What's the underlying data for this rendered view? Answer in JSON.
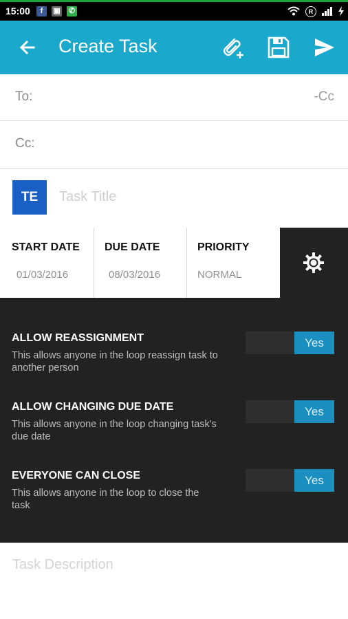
{
  "status_bar": {
    "time": "15:00",
    "notif_icons": [
      "facebook-icon",
      "gallery-icon",
      "whatsapp-icon"
    ],
    "right_icons": [
      "wifi-icon",
      "r-icon",
      "signal-icon",
      "charging-icon"
    ],
    "r_glyph": "R"
  },
  "app_bar": {
    "title": "Create Task",
    "color": "#1aa8cc"
  },
  "recipients": {
    "to_label": "To:",
    "cc_toggle": "-Cc",
    "cc_label": "Cc:"
  },
  "task": {
    "avatar_initials": "TE",
    "avatar_color": "#1a5fc4",
    "title_placeholder": "Task Title"
  },
  "meta": {
    "start_date": {
      "label": "START DATE",
      "value": "01/03/2016"
    },
    "due_date": {
      "label": "DUE DATE",
      "value": "08/03/2016"
    },
    "priority": {
      "label": "PRIORITY",
      "value": "NORMAL"
    }
  },
  "settings": [
    {
      "title": "ALLOW REASSIGNMENT",
      "description": "This allows anyone in the loop reassign task to another person",
      "toggle": "Yes"
    },
    {
      "title": "ALLOW CHANGING DUE DATE",
      "description": "This allows anyone in the loop changing task's due date",
      "toggle": "Yes"
    },
    {
      "title": "EVERYONE CAN CLOSE",
      "description": "This allows anyone in the loop to close the task",
      "toggle": "Yes"
    }
  ],
  "description": {
    "placeholder": "Task Description"
  }
}
